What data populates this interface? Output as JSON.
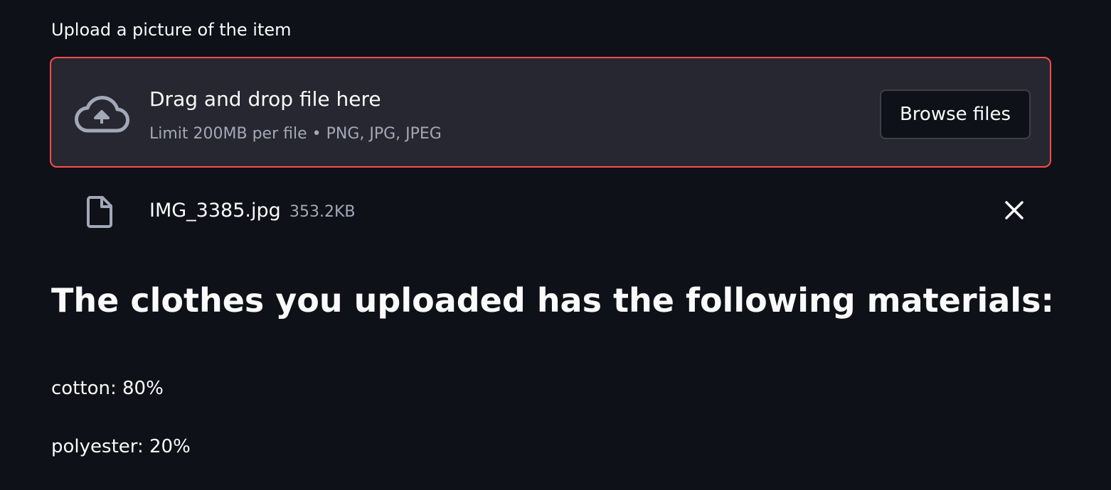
{
  "uploader": {
    "label": "Upload a picture of the item",
    "dropzone_title": "Drag and drop file here",
    "dropzone_limit": "Limit 200MB per file • PNG, JPG, JPEG",
    "browse_label": "Browse files",
    "accent_color": "#ff4b4b"
  },
  "uploaded_file": {
    "name": "IMG_3385.jpg",
    "size": "353.2KB",
    "icon": "file-icon",
    "remove_icon": "close-icon"
  },
  "result": {
    "heading": "The clothes you uploaded has the following materials:",
    "materials": [
      {
        "text": "cotton: 80%"
      },
      {
        "text": "polyester: 20%"
      }
    ]
  }
}
